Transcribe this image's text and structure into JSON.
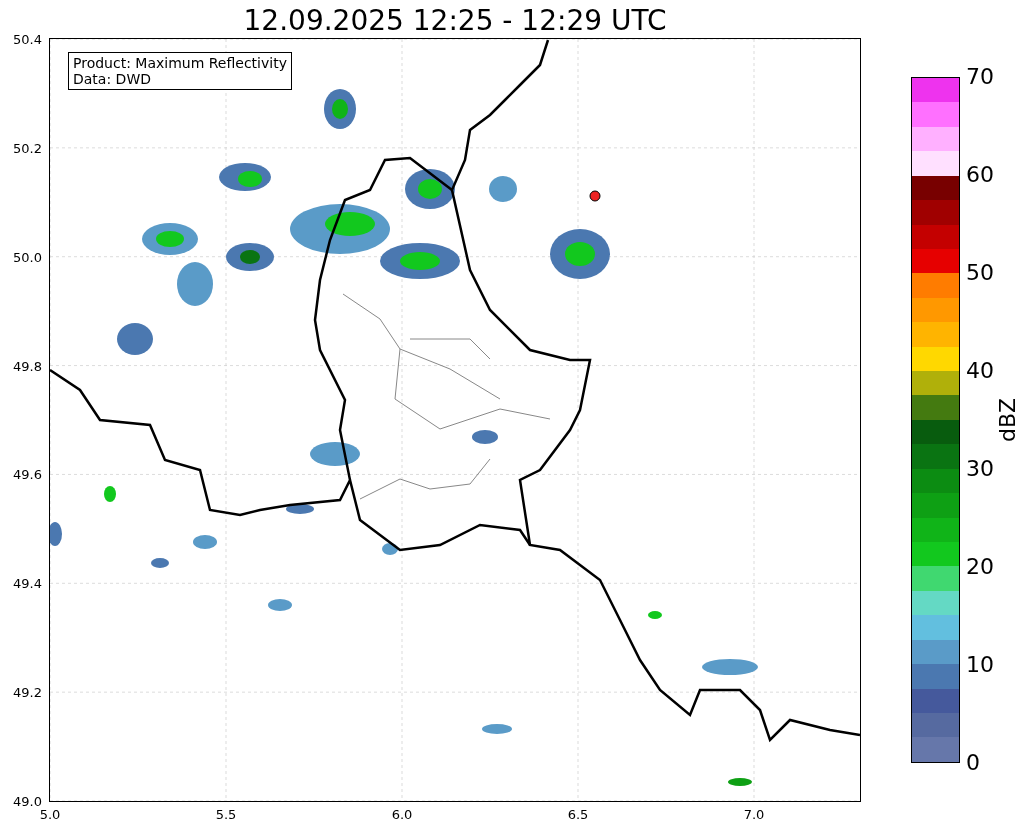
{
  "title": "12.09.2025 12:25 - 12:29 UTC",
  "legend": {
    "lines": [
      "Product: Maximum Reflectivity",
      "Data: DWD"
    ]
  },
  "x_ticks": [
    "5.0",
    "5.5",
    "6.0",
    "6.5",
    "7.0"
  ],
  "y_ticks": [
    "50.4",
    "50.2",
    "50.0",
    "49.8",
    "49.6",
    "49.4",
    "49.2",
    "49.0"
  ],
  "colorbar": {
    "label": "dBZ",
    "ticks": [
      "70",
      "60",
      "50",
      "40",
      "30",
      "20",
      "10",
      "0"
    ],
    "bands": [
      {
        "color": "#ee33ee"
      },
      {
        "color": "#ff70ff"
      },
      {
        "color": "#ffb0ff"
      },
      {
        "color": "#ffe0ff"
      },
      {
        "color": "#780000"
      },
      {
        "color": "#a00000"
      },
      {
        "color": "#c40000"
      },
      {
        "color": "#e60000"
      },
      {
        "color": "#ff7c00"
      },
      {
        "color": "#ff9800"
      },
      {
        "color": "#ffb400"
      },
      {
        "color": "#ffd800"
      },
      {
        "color": "#b0b00a"
      },
      {
        "color": "#447a10"
      },
      {
        "color": "#085c0e"
      },
      {
        "color": "#0a7412"
      },
      {
        "color": "#0c8c12"
      },
      {
        "color": "#0ea014"
      },
      {
        "color": "#10b418"
      },
      {
        "color": "#12c81e"
      },
      {
        "color": "#40d870"
      },
      {
        "color": "#64d9c4"
      },
      {
        "color": "#62bfdf"
      },
      {
        "color": "#5a9bc8"
      },
      {
        "color": "#4b78b0"
      },
      {
        "color": "#45599c"
      },
      {
        "color": "#566aa0"
      },
      {
        "color": "#6677aa"
      }
    ]
  }
}
